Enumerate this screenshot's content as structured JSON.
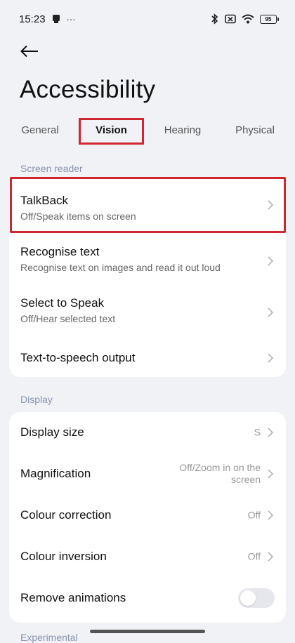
{
  "status": {
    "time": "15:23",
    "more": "···",
    "battery": "95"
  },
  "page": {
    "title": "Accessibility"
  },
  "tabs": [
    "General",
    "Vision",
    "Hearing",
    "Physical"
  ],
  "screen_reader": {
    "label": "Screen reader",
    "items": [
      {
        "label": "TalkBack",
        "sub": "Off/Speak items on screen"
      },
      {
        "label": "Recognise text",
        "sub": "Recognise text on images and read it out loud"
      },
      {
        "label": "Select to Speak",
        "sub": "Off/Hear selected text"
      },
      {
        "label": "Text-to-speech output"
      }
    ]
  },
  "display": {
    "label": "Display",
    "items": [
      {
        "label": "Display size",
        "value": "S"
      },
      {
        "label": "Magnification",
        "value_line1": "Off/Zoom in on the",
        "value_line2": "screen"
      },
      {
        "label": "Colour correction",
        "value": "Off"
      },
      {
        "label": "Colour inversion",
        "value": "Off"
      },
      {
        "label": "Remove animations",
        "toggle": false
      }
    ]
  },
  "experimental": {
    "label": "Experimental"
  },
  "colors": {
    "accent_highlight": "#d0262f",
    "section": "#8a94ad",
    "background": "#f1f2f6"
  }
}
